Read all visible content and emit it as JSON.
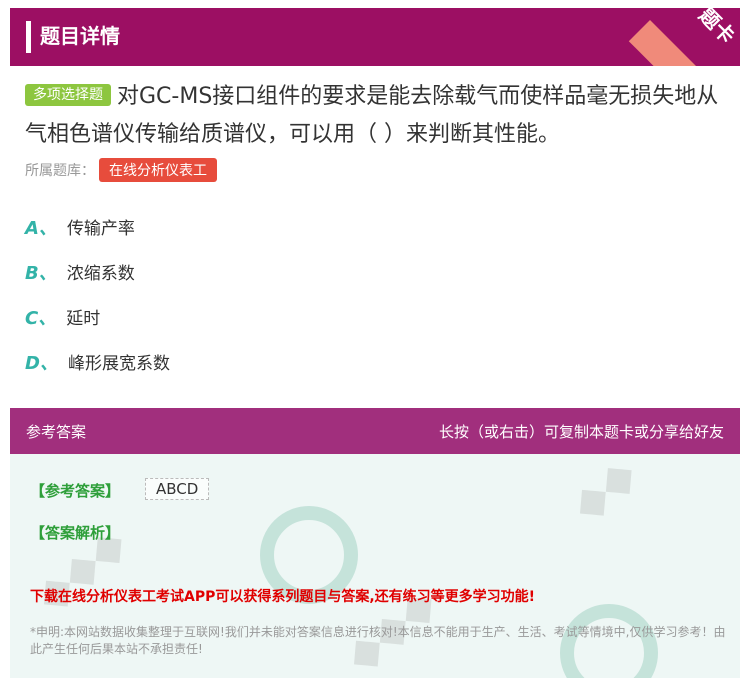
{
  "header": {
    "title": "题目详情",
    "corner_label": "题卡"
  },
  "question": {
    "type_tag": "多项选择题",
    "text": "对GC-MS接口组件的要求是能去除载气而使样品毫无损失地从气相色谱仪传输给质谱仪，可以用（ ）来判断其性能。"
  },
  "bank": {
    "label": "所属题库：",
    "name": "在线分析仪表工"
  },
  "options": [
    {
      "letter": "A、",
      "text": "传输产率"
    },
    {
      "letter": "B、",
      "text": "浓缩系数"
    },
    {
      "letter": "C、",
      "text": "延时"
    },
    {
      "letter": "D、",
      "text": "峰形展宽系数"
    }
  ],
  "answer_bar": {
    "left": "参考答案",
    "right": "长按（或右击）可复制本题卡或分享给好友"
  },
  "answer": {
    "answer_label": "【参考答案】",
    "answer_value": "ABCD",
    "analysis_label": "【答案解析】"
  },
  "promo": "下载在线分析仪表工考试APP可以获得系列题目与答案,还有练习等更多学习功能!",
  "disclaimer": "*申明:本网站数据收集整理于互联网!我们并未能对答案信息进行核对!本信息不能用于生产、生活、考试等情境中,仅供学习参考！由此产生任何后果本站不承担责任!",
  "colors": {
    "header": "#9c0f63",
    "answer_bar": "#a12f7d",
    "accent": "#33b3a8",
    "tag": "#8dc63f",
    "bank": "#e74c3c"
  }
}
